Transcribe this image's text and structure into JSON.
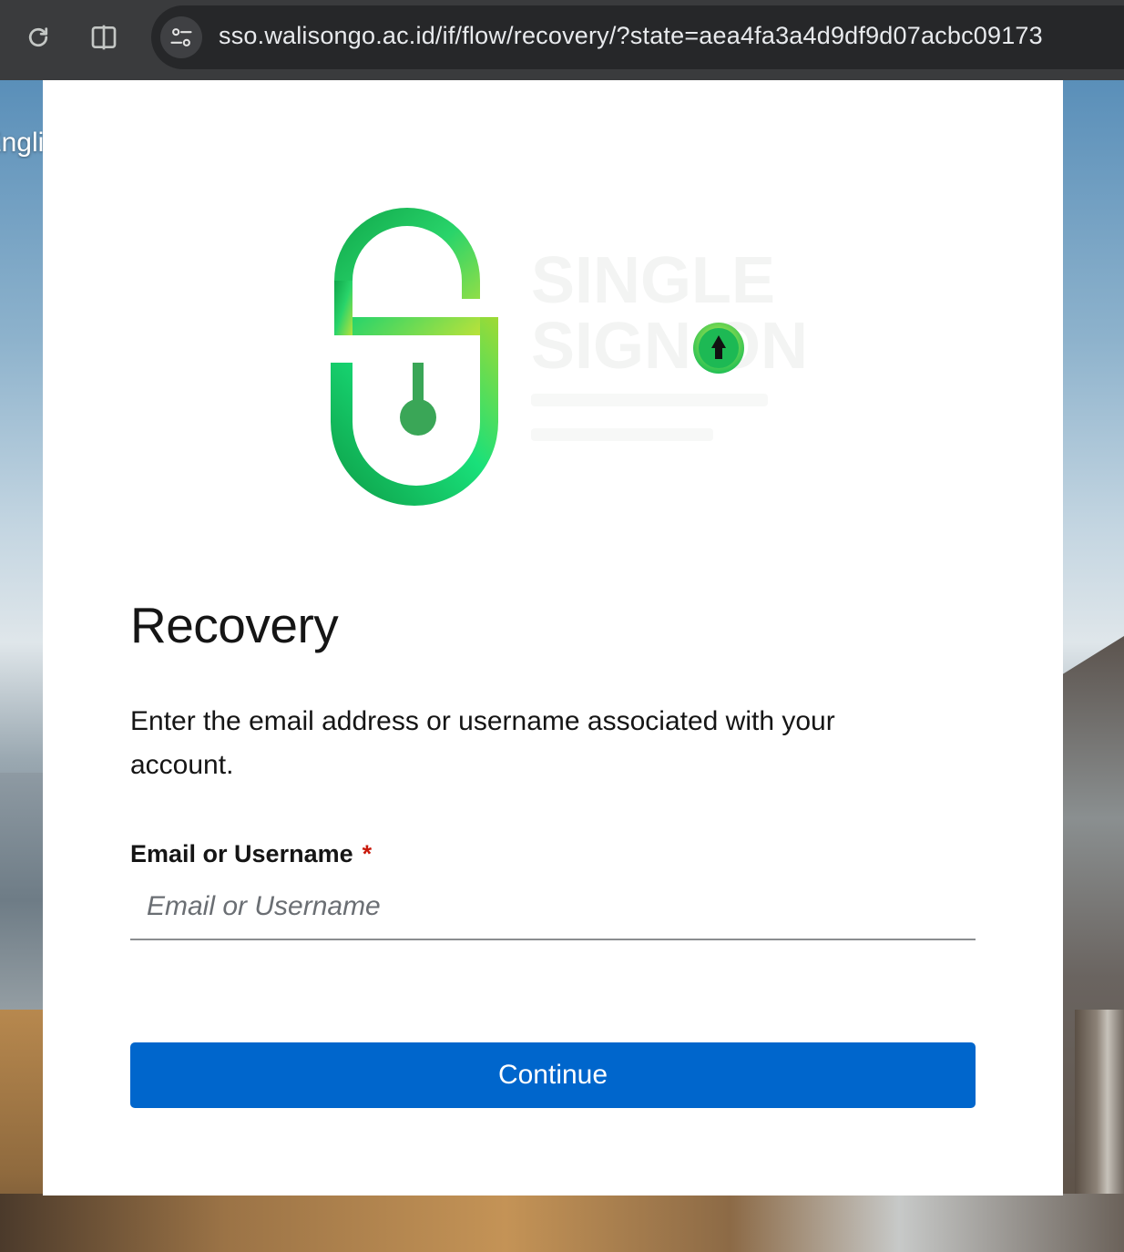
{
  "browser": {
    "url": "sso.walisongo.ac.id/if/flow/recovery/?state=aea4fa3a4d9df9d07acbc09173",
    "icons": {
      "reload": "reload-icon",
      "split": "split-view-icon",
      "site_info": "site-settings-icon"
    }
  },
  "language": {
    "label": "English"
  },
  "logo": {
    "name": "single-sign-on-logo",
    "colors": [
      "#16c25a",
      "#c8e63a",
      "#0f9d46"
    ]
  },
  "recovery": {
    "title": "Recovery",
    "description": "Enter the email address or username associated with your account.",
    "field_label": "Email or Username",
    "required_mark": "*",
    "input_placeholder": "Email or Username",
    "input_value": "",
    "continue_label": "Continue"
  },
  "colors": {
    "primary": "#0066cc",
    "required": "#c9190b",
    "text": "#151515"
  }
}
